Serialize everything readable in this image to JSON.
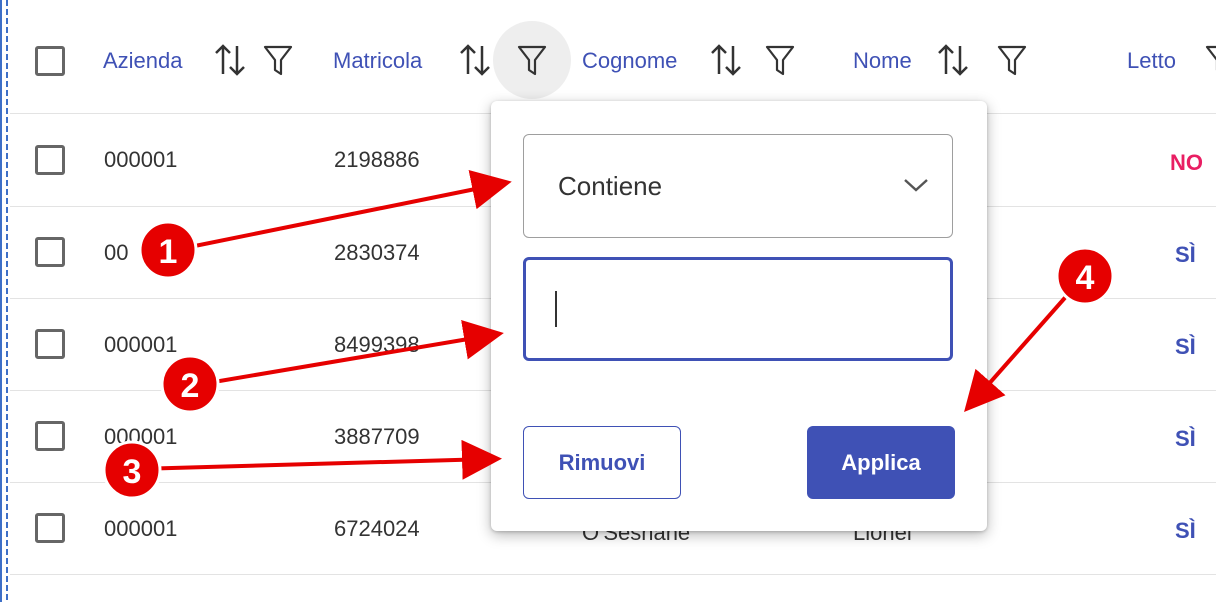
{
  "table": {
    "columns": [
      {
        "label": "Azienda"
      },
      {
        "label": "Matricola"
      },
      {
        "label": "Cognome"
      },
      {
        "label": "Nome"
      },
      {
        "label": "Letto"
      }
    ],
    "rows": [
      {
        "azienda": "000001",
        "matricola": "2198886",
        "cognome": "",
        "nome": "",
        "letto": "NO"
      },
      {
        "azienda": "00",
        "matricola": "2830374",
        "cognome": "",
        "nome": "",
        "letto": "SÌ"
      },
      {
        "azienda": "000001",
        "matricola": "8499398",
        "cognome": "",
        "nome": "",
        "letto": "SÌ"
      },
      {
        "azienda": "000001",
        "matricola": "3887709",
        "cognome": "",
        "nome": "",
        "letto": "SÌ"
      },
      {
        "azienda": "000001",
        "matricola": "6724024",
        "cognome": "O'Sesnane",
        "nome": "Lionel",
        "letto": "SÌ"
      }
    ]
  },
  "filter_popup": {
    "operator_selected": "Contiene",
    "value": "",
    "remove_label": "Rimuovi",
    "apply_label": "Applica"
  },
  "annotations": {
    "markers": [
      "1",
      "2",
      "3",
      "4"
    ]
  },
  "colors": {
    "primary": "#3f51b5",
    "no": "#e91e63",
    "yes": "#3f51b5",
    "annotation": "#e60000"
  }
}
